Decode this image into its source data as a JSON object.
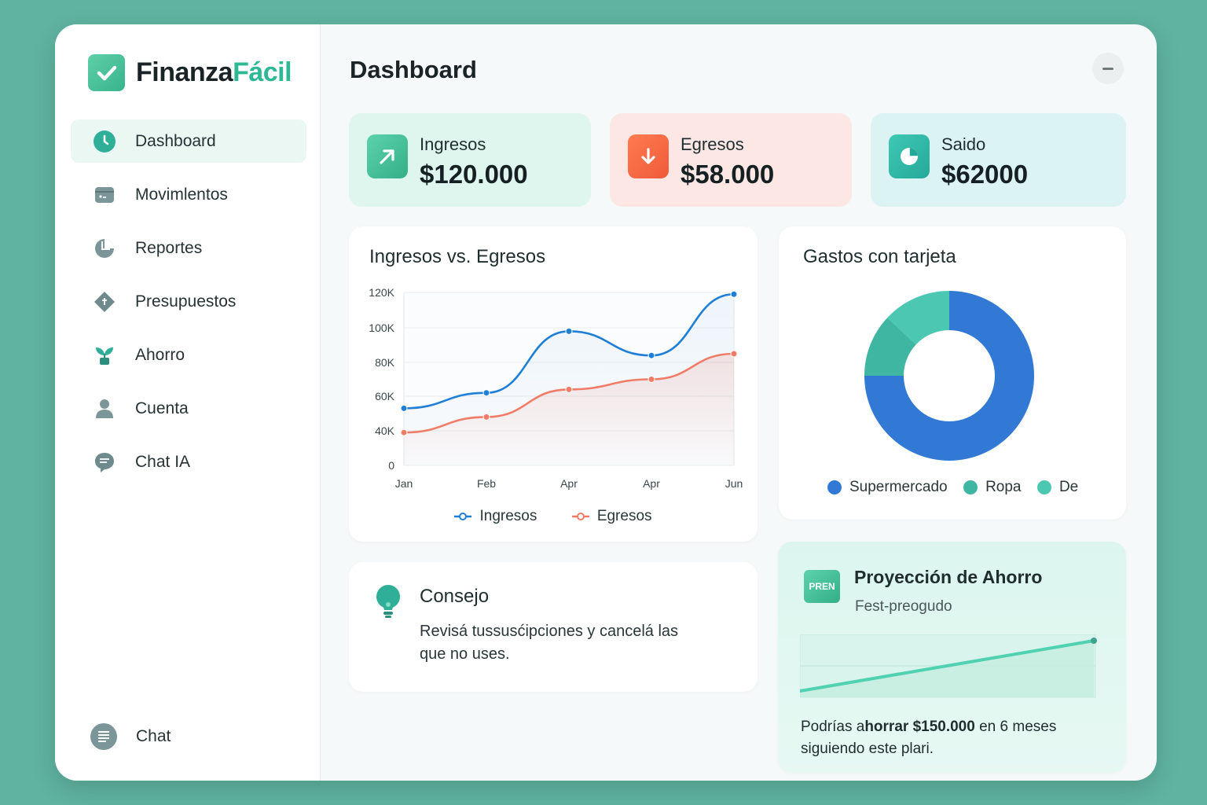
{
  "app": {
    "brand_part1": "Finanza",
    "brand_part2": "Fácil"
  },
  "sidebar": {
    "items": [
      {
        "label": "Dashboard",
        "icon": "clock-icon"
      },
      {
        "label": "Movimlentos",
        "icon": "wallet-icon"
      },
      {
        "label": "Reportes",
        "icon": "pie-icon"
      },
      {
        "label": "Presupuestos",
        "icon": "diamond-icon"
      },
      {
        "label": "Ahorro",
        "icon": "plant-icon"
      },
      {
        "label": "Cuenta",
        "icon": "user-icon"
      },
      {
        "label": "Chat IA",
        "icon": "chat-bubble-icon"
      }
    ],
    "bottom_label": "Chat"
  },
  "header": {
    "title": "Dashboard"
  },
  "stats": {
    "income": {
      "label": "Ingresos",
      "value": "$120.000",
      "color": "#3dbb92"
    },
    "expense": {
      "label": "Egresos",
      "value": "$58.000",
      "color": "#f06a45"
    },
    "balance": {
      "label": "Saido",
      "value": "$62000",
      "color": "#2bb4a6"
    }
  },
  "line_card": {
    "title": "Ingresos vs. Egresos"
  },
  "donut_card": {
    "title": "Gastos con tarjeta"
  },
  "tip": {
    "title": "Consejo",
    "text_line1": "Revisá tussusćipciones y cancelá las",
    "text_line2": "que no uses."
  },
  "projection": {
    "badge": "PREN",
    "title": "Proyección de Ahorro",
    "subtitle": "Fest-preogudo",
    "text_part1": "Podrías a",
    "text_bold": "horrar $150.000",
    "text_part2": " en 6 meses",
    "text_line2": "siguiendo este plari.",
    "trend": [
      0,
      1
    ]
  },
  "chart_data": [
    {
      "type": "line",
      "title": "Ingresos vs. Egresos",
      "categories": [
        "Jan",
        "Feb",
        "Apr",
        "Apr",
        "Jun"
      ],
      "y_ticks": [
        "0",
        "40K",
        "60K",
        "80K",
        "100K",
        "120K"
      ],
      "y_tick_values": [
        0,
        40000,
        60000,
        80000,
        100000,
        120000
      ],
      "series": [
        {
          "name": "Ingresos",
          "color": "#1f7fd6",
          "values": [
            53000,
            62000,
            98000,
            84000,
            119000
          ]
        },
        {
          "name": "Egresos",
          "color": "#f07c68",
          "values": [
            38000,
            48000,
            64000,
            70000,
            85000
          ]
        }
      ],
      "legend": "bottom"
    },
    {
      "type": "pie",
      "title": "Gastos con tarjeta",
      "labels": [
        "Supermercado",
        "Ropa",
        "De"
      ],
      "values": [
        75,
        12,
        13
      ],
      "colors": [
        "#3179d4",
        "#3fb6a2",
        "#4cc8b2"
      ],
      "legend": "bottom"
    }
  ]
}
